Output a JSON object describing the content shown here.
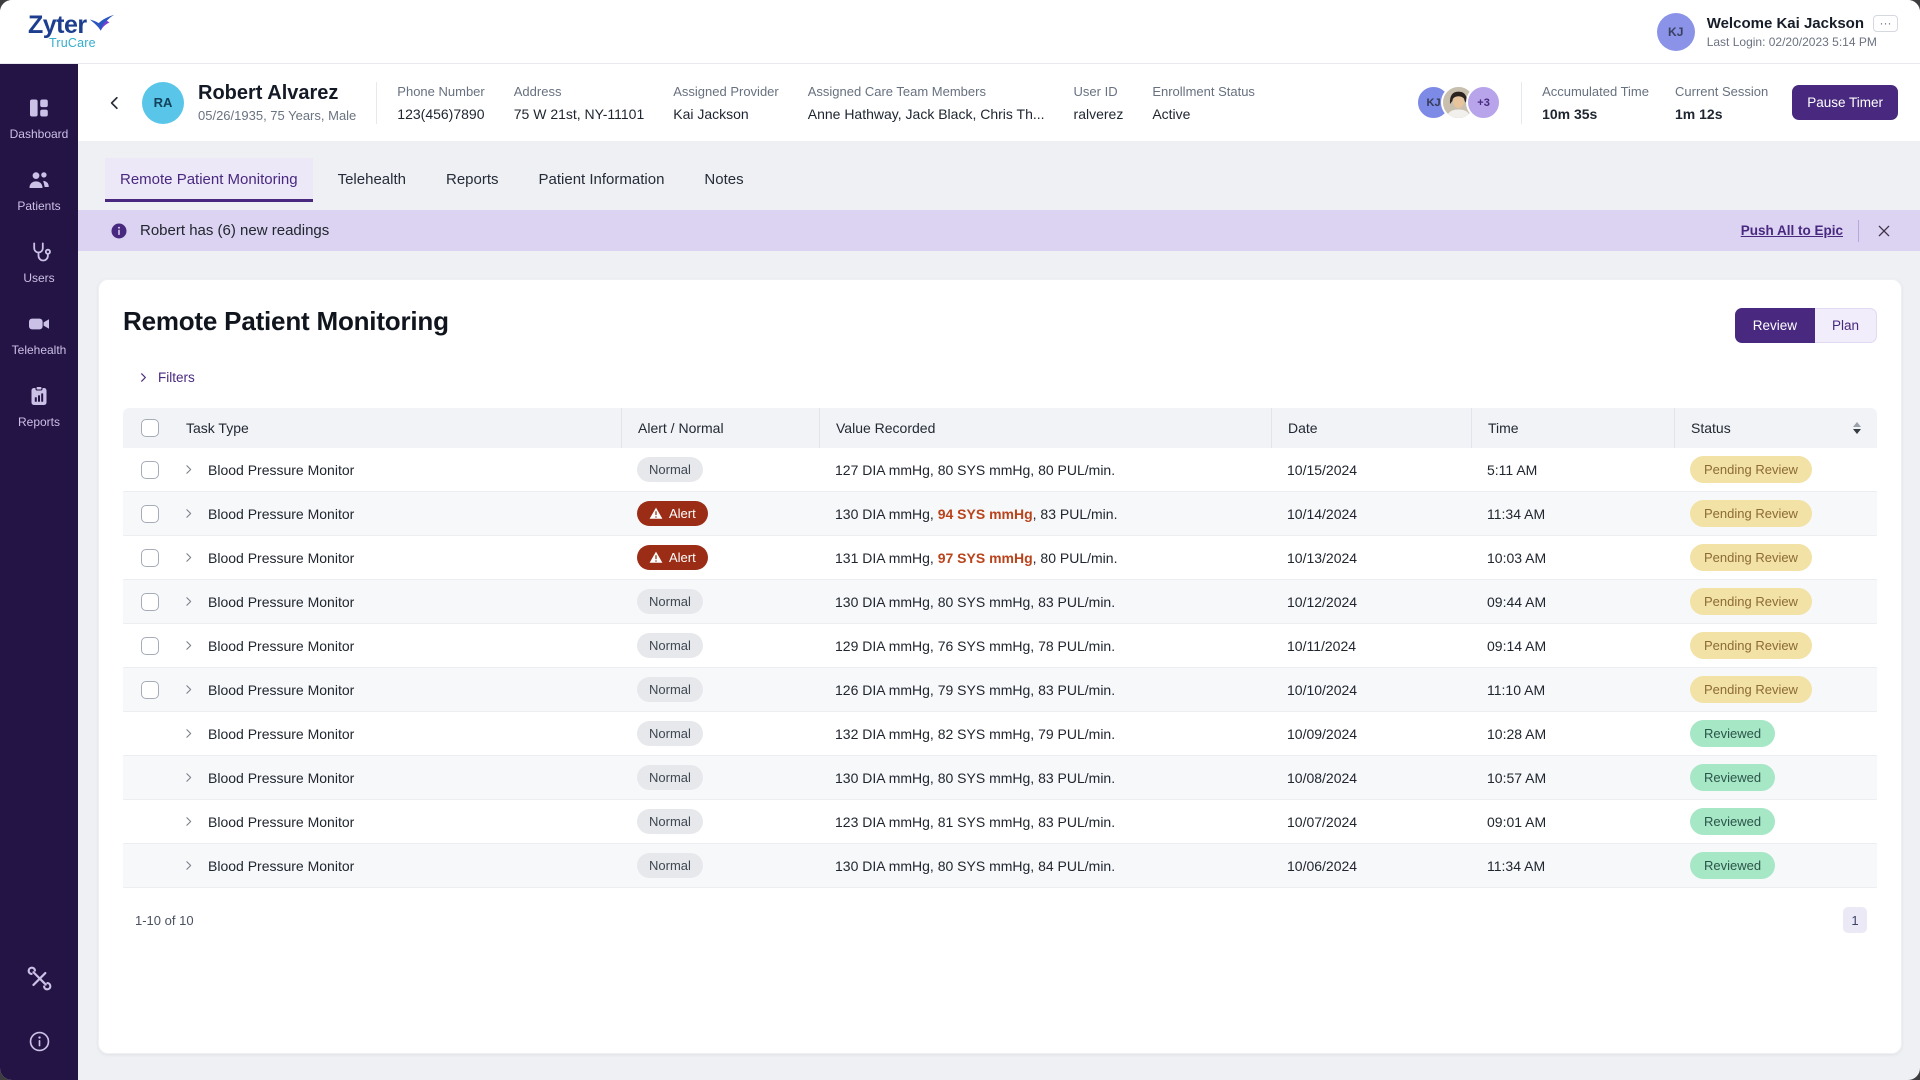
{
  "topbar": {
    "logo": {
      "brand": "Zyter",
      "sub": "TruCare"
    },
    "user": {
      "initials": "KJ",
      "welcome": "Welcome Kai Jackson",
      "menu": "···",
      "last_login": "Last Login: 02/20/2023 5:14 PM"
    }
  },
  "sidebar": {
    "items": [
      {
        "icon": "dashboard",
        "label": "Dashboard"
      },
      {
        "icon": "patients",
        "label": "Patients"
      },
      {
        "icon": "users",
        "label": "Users"
      },
      {
        "icon": "telehealth",
        "label": "Telehealth"
      },
      {
        "icon": "reports",
        "label": "Reports"
      }
    ]
  },
  "patient": {
    "initials": "RA",
    "name": "Robert Alvarez",
    "demographics": "05/26/1935, 75 Years, Male",
    "fields": [
      {
        "label": "Phone Number",
        "value": "123(456)7890"
      },
      {
        "label": "Address",
        "value": "75 W 21st, NY-11101"
      },
      {
        "label": "Assigned Provider",
        "value": "Kai Jackson"
      },
      {
        "label": "Assigned Care Team Members",
        "value": "Anne Hathway, Jack Black, Chris Th..."
      },
      {
        "label": "User ID",
        "value": "ralverez"
      },
      {
        "label": "Enrollment Status",
        "value": "Active"
      }
    ],
    "care_team_avatars": {
      "first": "KJ",
      "overflow": "+3"
    },
    "timers": [
      {
        "label": "Accumulated Time",
        "value": "10m 35s"
      },
      {
        "label": "Current Session",
        "value": "1m 12s"
      }
    ],
    "pause_button": "Pause Timer"
  },
  "tabs": [
    {
      "label": "Remote Patient Monitoring",
      "active": true
    },
    {
      "label": "Telehealth",
      "active": false
    },
    {
      "label": "Reports",
      "active": false
    },
    {
      "label": "Patient Information",
      "active": false
    },
    {
      "label": "Notes",
      "active": false
    }
  ],
  "banner": {
    "text": "Robert has (6) new readings",
    "action": "Push All to Epic"
  },
  "main": {
    "title": "Remote Patient Monitoring",
    "toggle": {
      "review": "Review",
      "plan": "Plan"
    },
    "filters_label": "Filters",
    "table": {
      "columns": [
        "Task Type",
        "Alert / Normal",
        "Value Recorded",
        "Date",
        "Time",
        "Status"
      ],
      "rows": [
        {
          "checkbox": true,
          "task": "Blood Pressure Monitor",
          "flag": "Normal",
          "value_pre": "127 DIA mmHg, 80 SYS mmHg, 80 PUL/min.",
          "value_alert": "",
          "value_post": "",
          "date": "10/15/2024",
          "time": "5:11 AM",
          "status": "Pending Review"
        },
        {
          "checkbox": true,
          "task": "Blood Pressure Monitor",
          "flag": "Alert",
          "value_pre": "130 DIA mmHg, ",
          "value_alert": "94 SYS mmHg",
          "value_post": ", 83 PUL/min.",
          "date": "10/14/2024",
          "time": "11:34 AM",
          "status": "Pending Review"
        },
        {
          "checkbox": true,
          "task": "Blood Pressure Monitor",
          "flag": "Alert",
          "value_pre": "131 DIA mmHg, ",
          "value_alert": "97 SYS mmHg",
          "value_post": ", 80 PUL/min.",
          "date": "10/13/2024",
          "time": "10:03 AM",
          "status": "Pending Review"
        },
        {
          "checkbox": true,
          "task": "Blood Pressure Monitor",
          "flag": "Normal",
          "value_pre": "130 DIA mmHg, 80 SYS mmHg, 83 PUL/min.",
          "value_alert": "",
          "value_post": "",
          "date": "10/12/2024",
          "time": "09:44 AM",
          "status": "Pending Review"
        },
        {
          "checkbox": true,
          "task": "Blood Pressure Monitor",
          "flag": "Normal",
          "value_pre": "129 DIA mmHg, 76 SYS mmHg, 78 PUL/min.",
          "value_alert": "",
          "value_post": "",
          "date": "10/11/2024",
          "time": "09:14 AM",
          "status": "Pending Review"
        },
        {
          "checkbox": true,
          "task": "Blood Pressure Monitor",
          "flag": "Normal",
          "value_pre": "126 DIA mmHg, 79 SYS mmHg, 83 PUL/min.",
          "value_alert": "",
          "value_post": "",
          "date": "10/10/2024",
          "time": "11:10 AM",
          "status": "Pending Review"
        },
        {
          "checkbox": false,
          "task": "Blood Pressure Monitor",
          "flag": "Normal",
          "value_pre": "132 DIA mmHg, 82 SYS mmHg, 79 PUL/min.",
          "value_alert": "",
          "value_post": "",
          "date": "10/09/2024",
          "time": "10:28 AM",
          "status": "Reviewed"
        },
        {
          "checkbox": false,
          "task": "Blood Pressure Monitor",
          "flag": "Normal",
          "value_pre": "130 DIA mmHg, 80 SYS mmHg, 83 PUL/min.",
          "value_alert": "",
          "value_post": "",
          "date": "10/08/2024",
          "time": "10:57 AM",
          "status": "Reviewed"
        },
        {
          "checkbox": false,
          "task": "Blood Pressure Monitor",
          "flag": "Normal",
          "value_pre": "123 DIA mmHg, 81 SYS mmHg, 83 PUL/min.",
          "value_alert": "",
          "value_post": "",
          "date": "10/07/2024",
          "time": "09:01 AM",
          "status": "Reviewed"
        },
        {
          "checkbox": false,
          "task": "Blood Pressure Monitor",
          "flag": "Normal",
          "value_pre": "130 DIA mmHg, 80 SYS mmHg, 84 PUL/min.",
          "value_alert": "",
          "value_post": "",
          "date": "10/06/2024",
          "time": "11:34 AM",
          "status": "Reviewed"
        }
      ]
    },
    "pagination": {
      "range": "1-10 of 10",
      "page": "1"
    }
  },
  "colors": {
    "primary_purple": "#48297F",
    "sidebar_bg": "#241345",
    "banner_bg": "#DCD3F2",
    "alert_badge": "#9B2D16",
    "alert_text": "#B9441C",
    "pending_bg": "#F2E2A6",
    "reviewed_bg": "#A6E7C5",
    "patient_avatar": "#58C5E9"
  }
}
